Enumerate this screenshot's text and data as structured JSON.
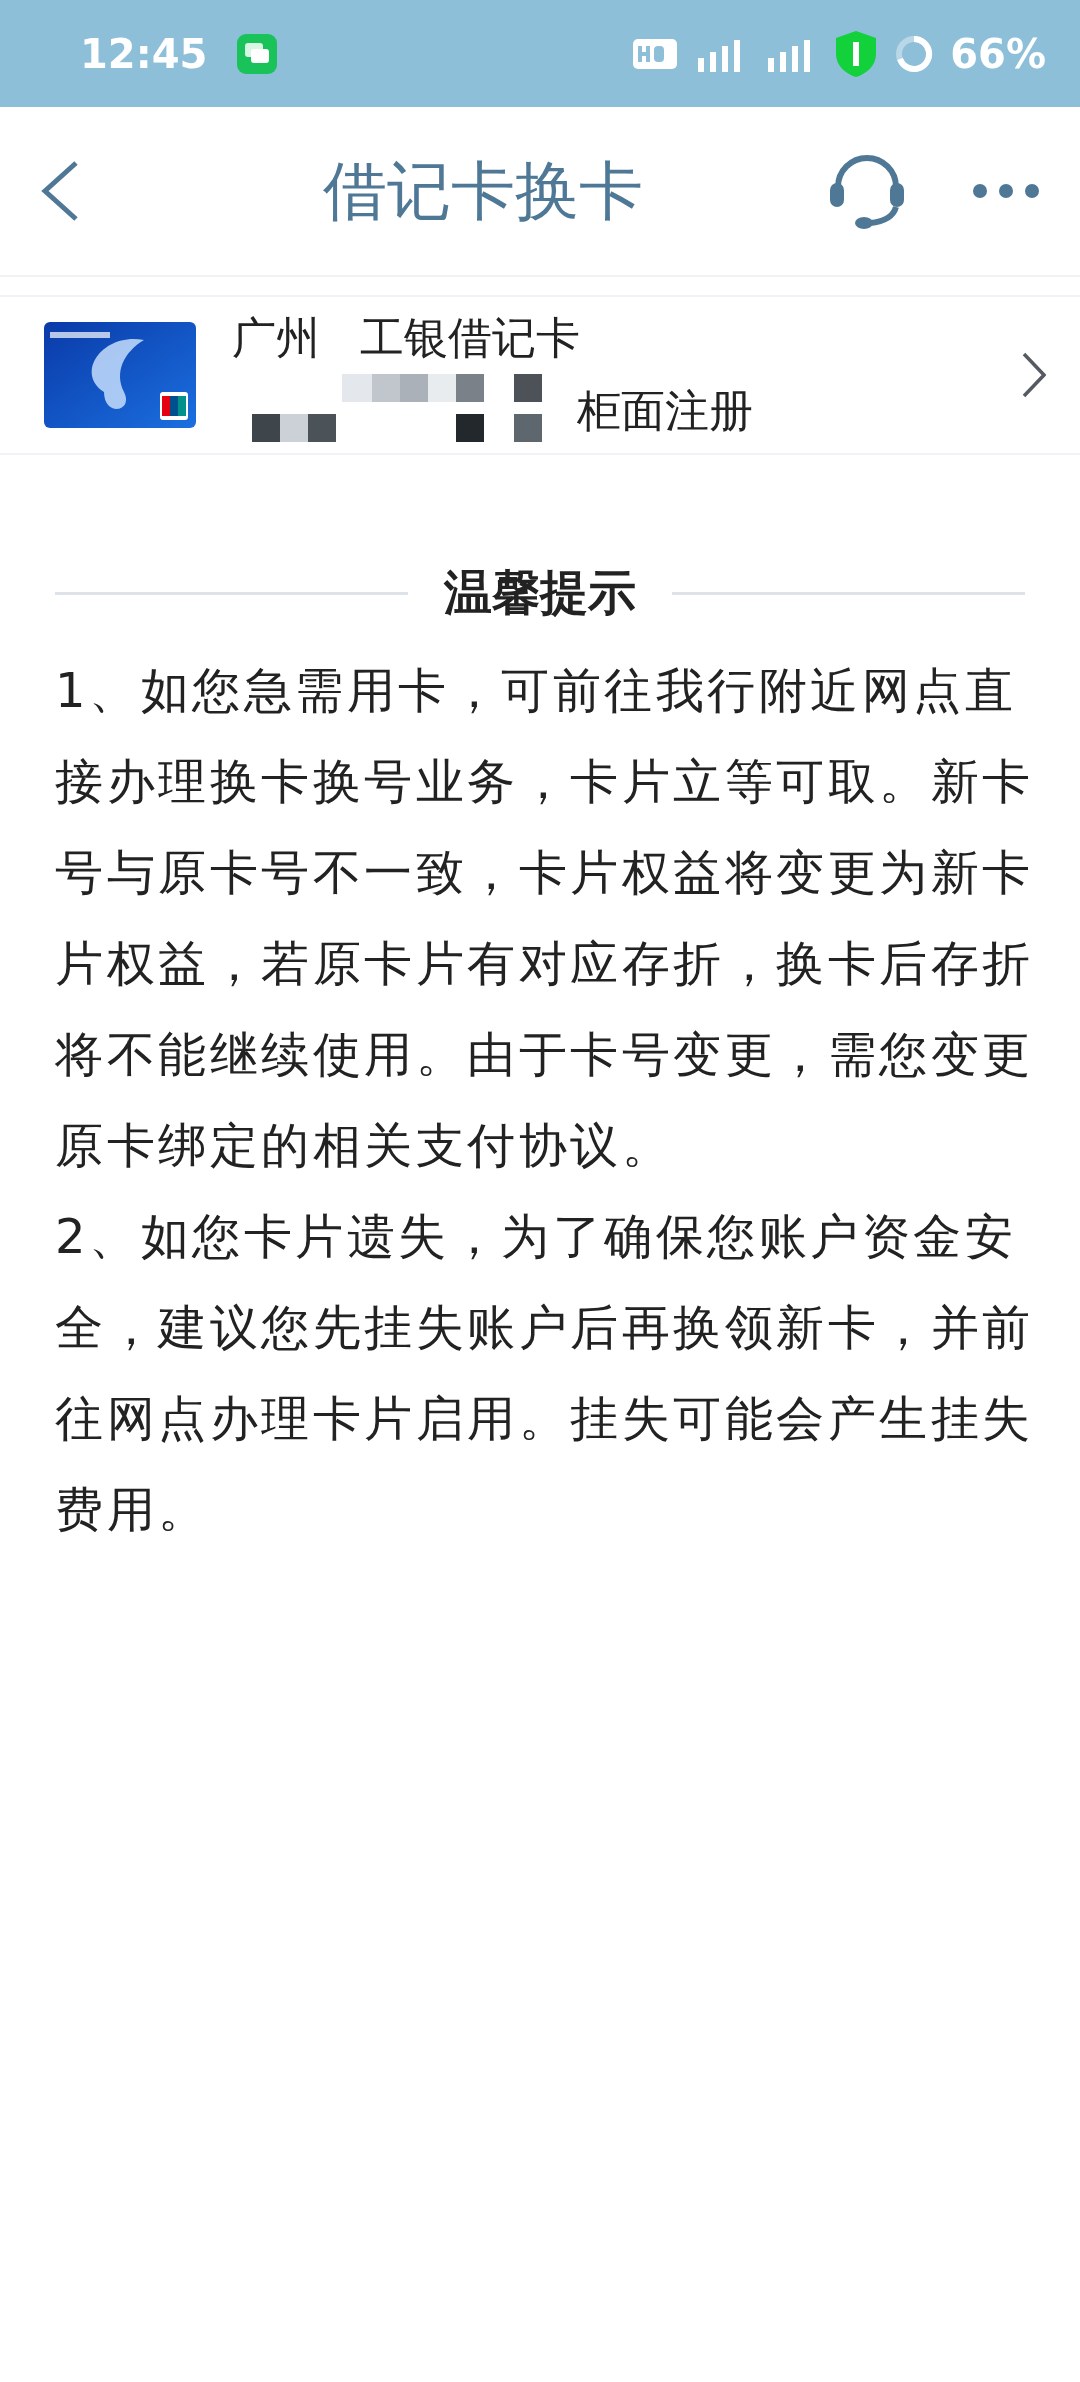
{
  "status_bar": {
    "time": "12:45",
    "battery": "66%"
  },
  "header": {
    "title": "借记卡换卡"
  },
  "card": {
    "city": "广州",
    "name": "工银借记卡",
    "channel": "柜面注册"
  },
  "notice": {
    "title": "温馨提示",
    "paragraphs": [
      "1、如您急需用卡，可前往我行附近网点直接办理换卡换号业务，卡片立等可取。新卡号与原卡号不一致，卡片权益将变更为新卡片权益，若原卡片有对应存折，换卡后存折将不能继续使用。由于卡号变更，需您变更原卡绑定的相关支付协议。",
      "2、如您卡片遗失，为了确保您账户资金安全，建议您先挂失账户后再换领新卡，并前往网点办理卡片启用。挂失可能会产生挂失费用。"
    ]
  }
}
